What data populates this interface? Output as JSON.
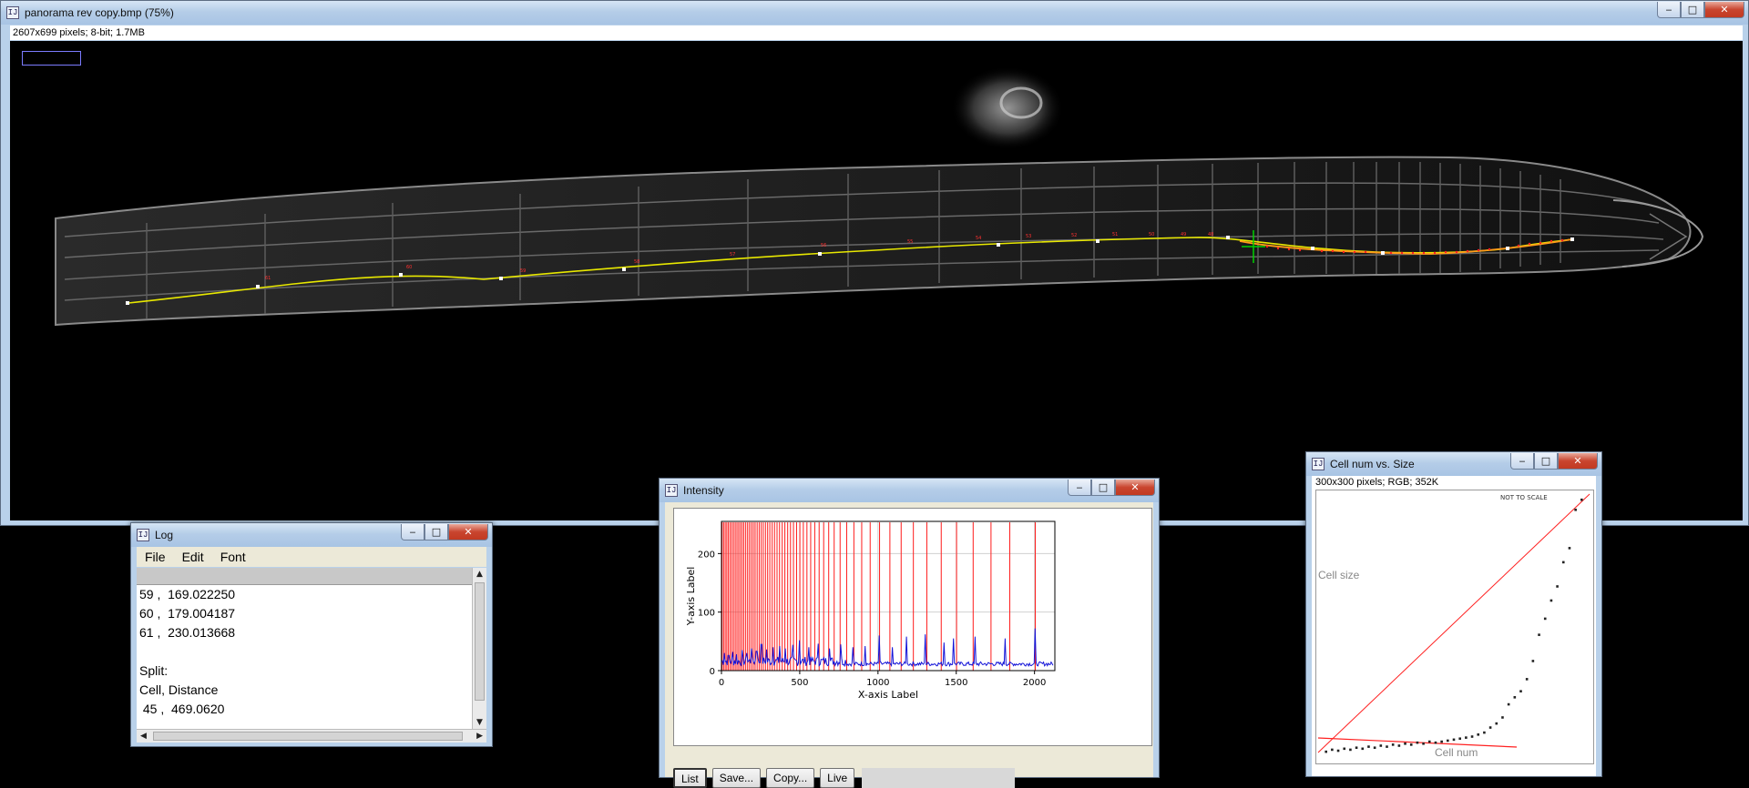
{
  "main_window": {
    "title": "panorama rev copy.bmp (75%)",
    "info": "2607x699 pixels; 8-bit; 1.7MB"
  },
  "log_window": {
    "title": "Log",
    "menu": [
      "File",
      "Edit",
      "Font"
    ],
    "lines": [
      "59 ,  169.022250",
      "60 ,  179.004187",
      "61 ,  230.013668",
      "",
      "Split:",
      "Cell, Distance",
      " 45 ,  469.0620"
    ]
  },
  "plot_window": {
    "title": "Intensity",
    "buttons": [
      "List",
      "Save...",
      "Copy...",
      "Live"
    ],
    "status_text": ""
  },
  "cell_window": {
    "title": "Cell num vs. Size",
    "info": "300x300 pixels; RGB; 352K",
    "not_to_scale": "NOT TO SCALE",
    "y_label": "Cell size",
    "x_label": "Cell num"
  },
  "window_controls": {
    "minimize": "‒",
    "maximize": "□",
    "close": "✕"
  },
  "colors": {
    "title_gradient": "#b5cde8",
    "trace_yellow": "#e8e800",
    "trace_orange": "#ff9a1a",
    "markers_red": "#ff2020",
    "plot_blue": "#1414d8",
    "plot_red": "#ff1c1c"
  },
  "chart_data": {
    "type": "line",
    "title": "",
    "xlabel": "X-axis Label",
    "ylabel": "Y-axis Label",
    "xlim": [
      0,
      2130
    ],
    "ylim": [
      0,
      255
    ],
    "x_ticks": [
      0,
      500,
      1000,
      1500,
      2000
    ],
    "y_ticks": [
      0,
      100,
      200
    ],
    "grid": true,
    "red_marker_x": [
      4,
      14,
      24,
      34,
      44,
      55,
      66,
      77,
      88,
      99,
      110,
      121,
      132,
      143,
      155,
      167,
      179,
      191,
      203,
      215,
      228,
      241,
      254,
      267,
      281,
      295,
      309,
      324,
      339,
      355,
      371,
      388,
      405,
      423,
      441,
      460,
      480,
      501,
      523,
      546,
      570,
      596,
      624,
      653,
      685,
      720,
      758,
      800,
      846,
      896,
      950,
      1010,
      1076,
      1148,
      1226,
      1312,
      1404,
      1502,
      1608,
      1722,
      1842,
      2005
    ],
    "blue_series": {
      "baseline": 8,
      "peaks": [
        {
          "x": 20,
          "y": 30
        },
        {
          "x": 45,
          "y": 26
        },
        {
          "x": 70,
          "y": 32
        },
        {
          "x": 95,
          "y": 28
        },
        {
          "x": 130,
          "y": 35
        },
        {
          "x": 160,
          "y": 30
        },
        {
          "x": 190,
          "y": 38
        },
        {
          "x": 225,
          "y": 33
        },
        {
          "x": 255,
          "y": 45
        },
        {
          "x": 290,
          "y": 36
        },
        {
          "x": 330,
          "y": 40
        },
        {
          "x": 370,
          "y": 42
        },
        {
          "x": 410,
          "y": 38
        },
        {
          "x": 455,
          "y": 44
        },
        {
          "x": 500,
          "y": 52
        },
        {
          "x": 560,
          "y": 40
        },
        {
          "x": 620,
          "y": 46
        },
        {
          "x": 690,
          "y": 38
        },
        {
          "x": 760,
          "y": 45
        },
        {
          "x": 840,
          "y": 40
        },
        {
          "x": 920,
          "y": 42
        },
        {
          "x": 1010,
          "y": 60
        },
        {
          "x": 1090,
          "y": 40
        },
        {
          "x": 1180,
          "y": 58
        },
        {
          "x": 1300,
          "y": 62
        },
        {
          "x": 1420,
          "y": 48
        },
        {
          "x": 1480,
          "y": 55
        },
        {
          "x": 1620,
          "y": 58
        },
        {
          "x": 1810,
          "y": 55
        },
        {
          "x": 2005,
          "y": 72
        }
      ]
    }
  },
  "scatter_data": {
    "points": [
      [
        1,
        8
      ],
      [
        2,
        10
      ],
      [
        3,
        9
      ],
      [
        4,
        11
      ],
      [
        5,
        10
      ],
      [
        6,
        12
      ],
      [
        7,
        11
      ],
      [
        8,
        13
      ],
      [
        9,
        12
      ],
      [
        10,
        14
      ],
      [
        11,
        13
      ],
      [
        12,
        15
      ],
      [
        13,
        14
      ],
      [
        14,
        16
      ],
      [
        15,
        15
      ],
      [
        16,
        17
      ],
      [
        17,
        16
      ],
      [
        18,
        18
      ],
      [
        19,
        17
      ],
      [
        20,
        18
      ],
      [
        21,
        19
      ],
      [
        22,
        20
      ],
      [
        23,
        21
      ],
      [
        24,
        22
      ],
      [
        25,
        23
      ],
      [
        26,
        25
      ],
      [
        27,
        27
      ],
      [
        28,
        32
      ],
      [
        29,
        36
      ],
      [
        30,
        42
      ],
      [
        31,
        55
      ],
      [
        32,
        62
      ],
      [
        33,
        68
      ],
      [
        34,
        80
      ],
      [
        35,
        98
      ],
      [
        36,
        124
      ],
      [
        37,
        140
      ],
      [
        38,
        158
      ],
      [
        39,
        172
      ],
      [
        40,
        196
      ],
      [
        41,
        210
      ],
      [
        42,
        248
      ],
      [
        43,
        258
      ]
    ],
    "red_line_upper": [
      [
        0,
        0
      ],
      [
        300,
        300
      ]
    ],
    "red_line_lower": [
      [
        0,
        30
      ],
      [
        210,
        18
      ]
    ]
  }
}
